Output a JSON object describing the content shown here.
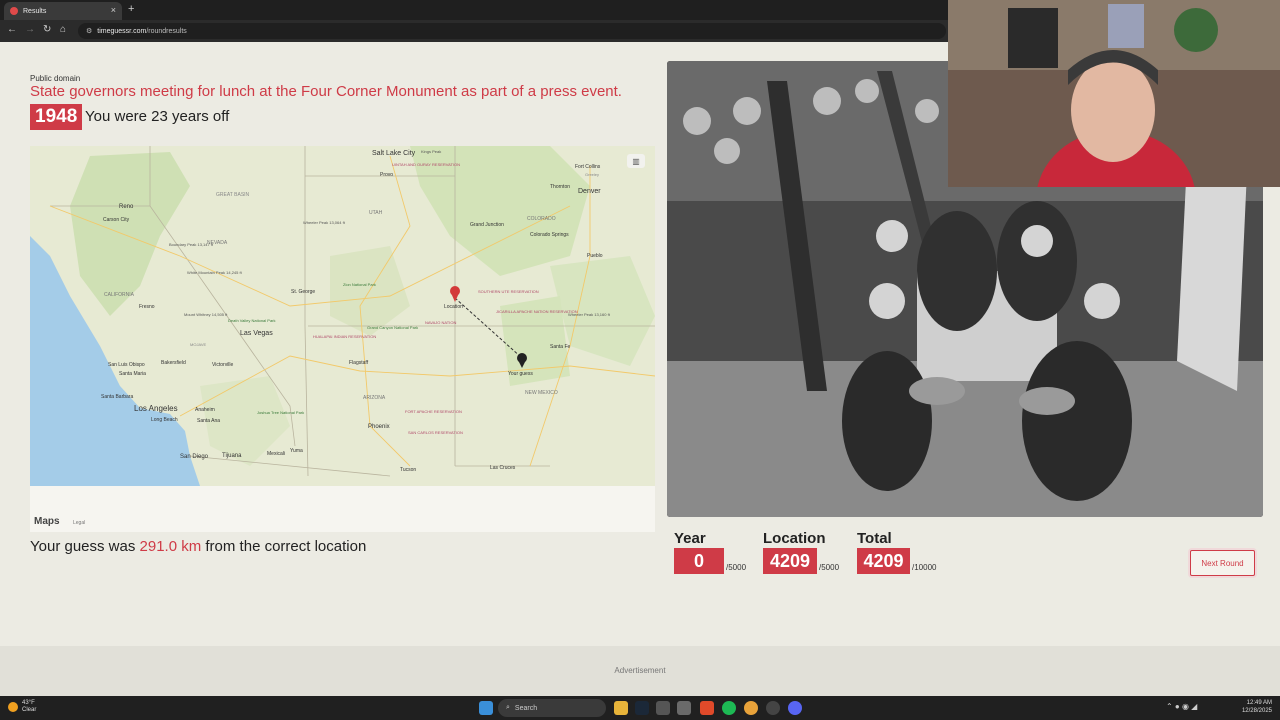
{
  "browser": {
    "tab_title": "Results",
    "tab_close": "×",
    "new_tab": "+",
    "url_host": "timeguessr.com",
    "url_path": "/roundresults"
  },
  "result": {
    "credit": "Public domain",
    "caption": "State governors meeting for lunch at the Four Corner Monument as part of a press event.",
    "year": "1948",
    "off_text": "You were 23 years off"
  },
  "map": {
    "logo": "Maps",
    "legal": "Legal",
    "layer_icon": "map-layers-icon",
    "labels": {
      "salt_lake": "Salt Lake City",
      "denver": "Denver",
      "fort_collins": "Fort Collins",
      "thornton": "Thornton",
      "reno": "Reno",
      "carson": "Carson City",
      "nevada": "NEVADA",
      "utah": "UTAH",
      "colorado": "COLORADO",
      "grand_junction": "Grand Junction",
      "colorado_springs": "Colorado Springs",
      "pueblo": "Pueblo",
      "california": "CALIFORNIA",
      "fresno": "Fresno",
      "st_george": "St. George",
      "las_vegas": "Las Vegas",
      "flagstaff": "Flagstaff",
      "arizona": "ARIZONA",
      "phoenix": "Phoenix",
      "tucson": "Tucson",
      "santa_fe": "Santa Fe",
      "new_mexico": "NEW MEXICO",
      "las_cruces": "Las Cruces",
      "bakersfield": "Bakersfield",
      "santa_maria": "Santa Maria",
      "san_luis_obispo": "San Luis Obispo",
      "santa_barbara": "Santa Barbara",
      "los_angeles": "Los Angeles",
      "long_beach": "Long Beach",
      "anaheim": "Anaheim",
      "santa_ana": "Santa Ana",
      "victorville": "Victorville",
      "san_diego": "San Diego",
      "tijuana": "Tijuana",
      "mexicali": "Mexicali",
      "yuma": "Yuma",
      "great_basin": "GREAT BASIN",
      "provo": "Provo",
      "greeley": "Greeley",
      "location": "Location",
      "your_guess": "Your guess",
      "death_valley": "Death Valley National Park",
      "grand_canyon": "Grand Canyon National Park",
      "joshua_tree": "Joshua Tree National Park",
      "zion": "Zion National Park",
      "mt_whitney": "Mount Whitney 14,505 ft",
      "wheeler": "Wheeler Peak 13,064 ft",
      "wheeler_nm": "Wheeler Peak 13,160 ft",
      "white_mtn": "White Mountain Peak 14,245 ft",
      "boundary_peak": "Boundary Peak 13,147 ft",
      "kings_peak": "Kings Peak",
      "fort_apache": "FORT APACHE RESERVATION",
      "san_carlos": "SAN CARLOS RESERVATION",
      "hualapai": "HUALAPAI INDIAN RESERVATION",
      "navajo": "NAVAJO NATION",
      "southern_ute": "SOUTHERN UTE RESERVATION",
      "jicarilla": "JICARILLA APACHE NATION RESERVATION",
      "uintah": "UINTAH AND OURAY RESERVATION",
      "mojave": "MOJAVE"
    }
  },
  "distance": {
    "prefix": "Your guess was ",
    "value": "291.0 km",
    "suffix": " from the correct location"
  },
  "scores": [
    {
      "label": "Year",
      "value": "0",
      "max": "/5000"
    },
    {
      "label": "Location",
      "value": "4209",
      "max": "/5000"
    },
    {
      "label": "Total",
      "value": "4209",
      "max": "/10000"
    }
  ],
  "next_button": "Next Round",
  "advertisement": "Advertisement",
  "taskbar": {
    "temp": "43°F",
    "condition": "Clear",
    "search": "Search",
    "time": "12:49 AM",
    "date": "12/28/2025"
  },
  "colors": {
    "accent": "#cf3b47",
    "page_bg": "#ecebe3",
    "map_land": "#e6ead0",
    "map_green": "#c9dcae",
    "map_water": "#9fc9e8"
  }
}
